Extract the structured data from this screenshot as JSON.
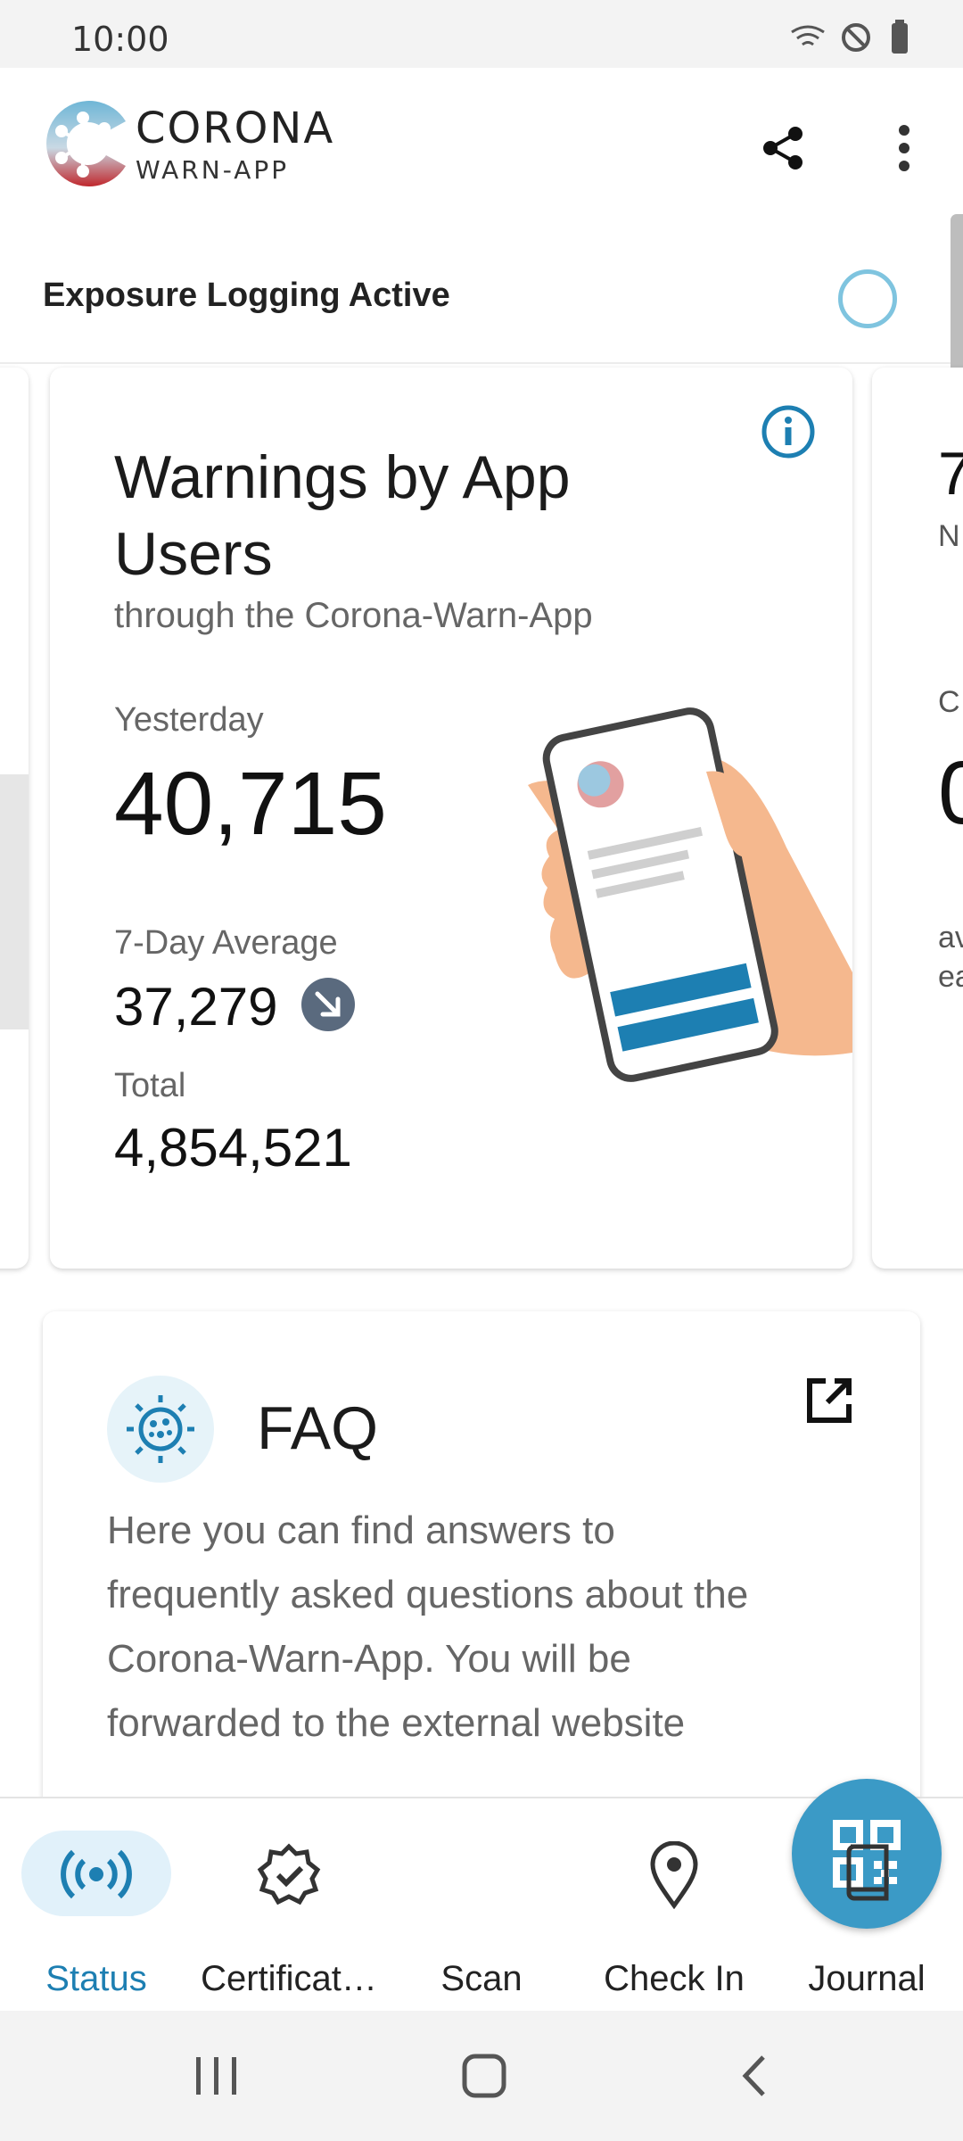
{
  "status_bar": {
    "time": "10:00"
  },
  "header": {
    "brand_line1": "CORONA",
    "brand_line2": "WARN-APP",
    "share_icon": "share-icon",
    "more_icon": "more-vertical-icon"
  },
  "exposure": {
    "label": "Exposure Logging Active"
  },
  "warnings_card": {
    "title": "Warnings by App Users",
    "subtitle": "through the Corona-Warn-App",
    "yesterday_label": "Yesterday",
    "yesterday_value": "40,715",
    "avg_label": "7-Day Average",
    "avg_value": "37,279",
    "avg_trend_icon": "trend-down-arrow-icon",
    "total_label": "Total",
    "total_value": "4,854,521"
  },
  "faq": {
    "title": "FAQ",
    "body": "Here you can find answers to frequently asked questions about the Corona-Warn-App. You will be forwarded to the external website"
  },
  "bottom_nav": {
    "items": [
      {
        "label": "Status",
        "icon": "broadcast-icon",
        "active": true
      },
      {
        "label": "Certificat…",
        "icon": "certificate-badge-icon",
        "active": false
      },
      {
        "label": "Scan",
        "icon": "qr-code-icon",
        "active": false
      },
      {
        "label": "Check In",
        "icon": "location-pin-icon",
        "active": false
      },
      {
        "label": "Journal",
        "icon": "book-icon",
        "active": false
      }
    ]
  },
  "colors": {
    "accent": "#1d7fb2",
    "fab": "#3b9ac6",
    "logo_red": "#c0282d"
  }
}
